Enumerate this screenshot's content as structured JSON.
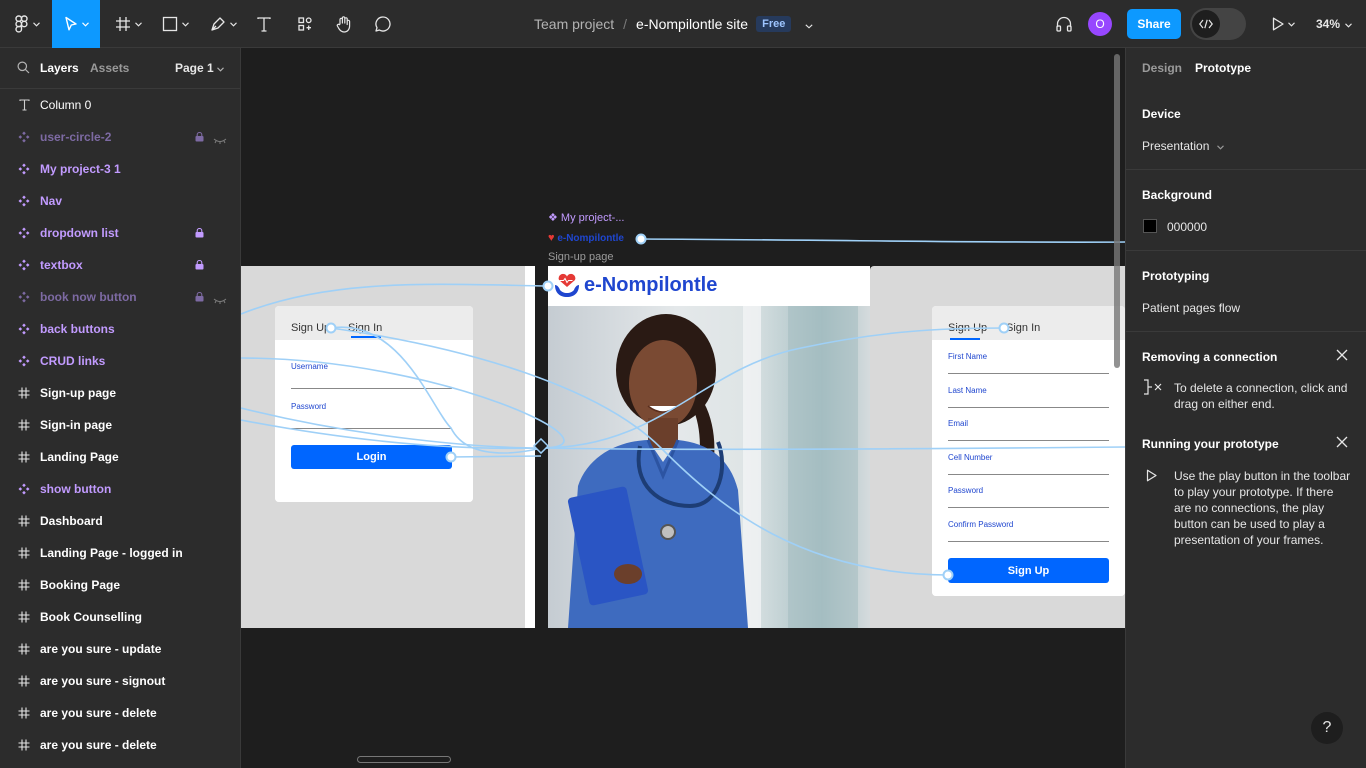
{
  "topbar": {
    "file_team": "Team project",
    "separator": "/",
    "file_name": "e-Nompilontle site",
    "badge": "Free",
    "avatar_initial": "O",
    "share_label": "Share",
    "zoom": "34%",
    "accent": "#0d99ff"
  },
  "left": {
    "tabs": [
      "Layers",
      "Assets"
    ],
    "page": "Page 1",
    "layers": [
      {
        "name": "Column 0",
        "icon": "text-icon",
        "kind": "text"
      },
      {
        "name": "user-circle-2",
        "icon": "component-icon",
        "kind": "dim",
        "locked": true,
        "hidden": true
      },
      {
        "name": "My project-3 1",
        "icon": "component-icon",
        "kind": "comp"
      },
      {
        "name": "Nav",
        "icon": "component-icon",
        "kind": "comp"
      },
      {
        "name": "dropdown list",
        "icon": "component-icon",
        "kind": "comp",
        "locked": true
      },
      {
        "name": "textbox",
        "icon": "component-icon",
        "kind": "comp",
        "locked": true
      },
      {
        "name": "book now button",
        "icon": "component-icon",
        "kind": "dim",
        "locked": true,
        "hidden": true
      },
      {
        "name": "back buttons",
        "icon": "component-icon",
        "kind": "comp"
      },
      {
        "name": "CRUD links",
        "icon": "component-icon",
        "kind": "comp"
      },
      {
        "name": "Sign-up page",
        "icon": "frame-icon",
        "kind": "frame"
      },
      {
        "name": "Sign-in page",
        "icon": "frame-icon",
        "kind": "frame"
      },
      {
        "name": "Landing Page",
        "icon": "frame-icon",
        "kind": "frame"
      },
      {
        "name": "show button",
        "icon": "component-icon",
        "kind": "comp"
      },
      {
        "name": "Dashboard",
        "icon": "frame-icon",
        "kind": "frame"
      },
      {
        "name": "Landing Page - logged in",
        "icon": "frame-icon",
        "kind": "frame"
      },
      {
        "name": "Booking Page",
        "icon": "frame-icon",
        "kind": "frame"
      },
      {
        "name": "Book Counselling",
        "icon": "frame-icon",
        "kind": "frame"
      },
      {
        "name": "are you sure - update",
        "icon": "frame-icon",
        "kind": "frame"
      },
      {
        "name": "are you sure - signout",
        "icon": "frame-icon",
        "kind": "frame"
      },
      {
        "name": "are you sure - delete",
        "icon": "frame-icon",
        "kind": "frame"
      },
      {
        "name": "are you sure - delete",
        "icon": "frame-icon",
        "kind": "frame"
      }
    ]
  },
  "canvas": {
    "label_project": "My project-...",
    "label_brand": "e-Nompilontle",
    "label_signup": "Sign-up page",
    "signin": {
      "tab_signup": "Sign Up",
      "tab_signin": "Sign In",
      "username": "Username",
      "password": "Password",
      "login": "Login"
    },
    "landing": {
      "brand": "e-Nompilontle"
    },
    "signup": {
      "tab_signup": "Sign Up",
      "tab_signin": "Sign In",
      "fields": [
        "First Name",
        "Last Name",
        "Email",
        "Cell Number",
        "Password",
        "Confirm Password"
      ],
      "submit": "Sign Up"
    }
  },
  "right": {
    "tabs": [
      "Design",
      "Prototype"
    ],
    "device_title": "Device",
    "device_value": "Presentation",
    "background_title": "Background",
    "background_value": "000000",
    "background_color": "#000000",
    "prototyping_title": "Prototyping",
    "flow_name": "Patient pages flow",
    "tip1_title": "Removing a connection",
    "tip1_text": "To delete a connection, click and drag on either end.",
    "tip2_title": "Running your prototype",
    "tip2_text": "Use the play button in the toolbar to play your prototype. If there are no connections, the play button can be used to play a presentation of your frames.",
    "help": "?"
  }
}
